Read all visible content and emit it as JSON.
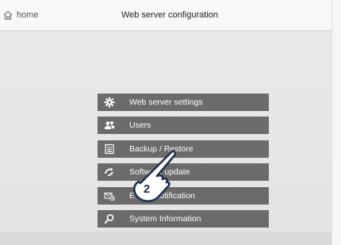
{
  "header": {
    "home_label": "home",
    "title": "Web server configuration"
  },
  "menu": {
    "items": [
      {
        "label": "Web server settings",
        "icon": "gear-icon"
      },
      {
        "label": "Users",
        "icon": "users-icon"
      },
      {
        "label": "Backup / Restore",
        "icon": "backup-icon"
      },
      {
        "label": "Software update",
        "icon": "update-icon"
      },
      {
        "label": "E-mail notification",
        "icon": "email-notification-icon"
      },
      {
        "label": "System Information",
        "icon": "search-icon"
      }
    ]
  },
  "overlay": {
    "step_number": "2",
    "cursor_icon": "pointing-hand-icon"
  },
  "colors": {
    "menu_bg": "#6b6b6b",
    "menu_text": "#ffffff",
    "background": "#e9e9e7"
  }
}
